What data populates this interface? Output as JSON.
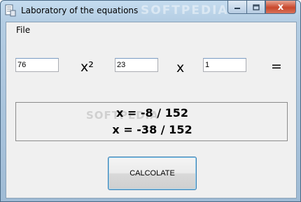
{
  "window": {
    "title": "Laboratory of the equations",
    "watermark": "SOFTPEDIA"
  },
  "caption": {
    "minimize_icon": "minimize-icon",
    "maximize_icon": "maximize-icon",
    "close_icon": "close-icon",
    "close_glyph": "x"
  },
  "menu": {
    "file_label": "File"
  },
  "equation": {
    "a_value": "76",
    "x_squared_label": "x²",
    "b_value": "23",
    "x_label": "x",
    "c_value": "1",
    "equals_label": "="
  },
  "result": {
    "line1": "x = -8 / 152",
    "line2": "x = -38 / 152",
    "watermark": "SOFTPEDIA"
  },
  "actions": {
    "calculate_label": "CALCOLATE"
  },
  "colors": {
    "title_bar": "#b4cde3",
    "close_button": "#c8482c",
    "button_border": "#3c7fb1",
    "client_background": "#f0f0f0"
  }
}
